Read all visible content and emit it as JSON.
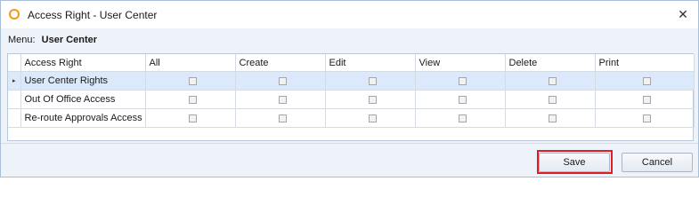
{
  "window": {
    "title": "Access Right - User Center",
    "close_glyph": "✕"
  },
  "menu": {
    "label": "Menu:",
    "value": "User Center"
  },
  "grid": {
    "row_indicator_glyph": "▸",
    "columns": [
      "Access Right",
      "All",
      "Create",
      "Edit",
      "View",
      "Delete",
      "Print"
    ],
    "rows": [
      {
        "name": "User Center Rights",
        "selected": true,
        "checks": [
          false,
          false,
          false,
          false,
          false,
          false
        ]
      },
      {
        "name": "Out Of Office Access",
        "selected": false,
        "checks": [
          false,
          false,
          false,
          false,
          false,
          false
        ]
      },
      {
        "name": "Re-route Approvals Access",
        "selected": false,
        "checks": [
          false,
          false,
          false,
          false,
          false,
          false
        ]
      }
    ]
  },
  "buttons": {
    "save_label": "Save",
    "cancel_label": "Cancel"
  },
  "colors": {
    "accent_icon": "#f29a1a",
    "selected_row": "#dce9fa",
    "highlight": "#e01b24"
  }
}
